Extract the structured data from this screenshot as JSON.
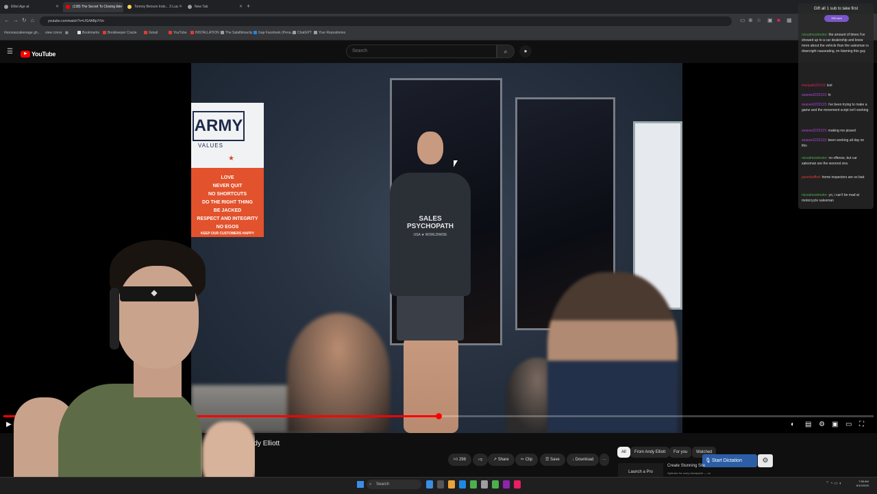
{
  "browser": {
    "tabs": [
      {
        "label": "Elliot Age at",
        "color": "#9e9e9e"
      },
      {
        "label": "(138) The Secret To Closing Eve",
        "color": "#ff0000"
      },
      {
        "label": "Tommy Benson Indo... 3 Lua",
        "color": "#ffd54f"
      },
      {
        "label": "New Tab",
        "color": "#9e9e9e"
      }
    ],
    "new_tab": "+",
    "url": "youtube.com/watch?v=LfG4ABp7rVo",
    "bookmarks": [
      {
        "label": "#sonvascaleenage gh...",
        "color": "#888888"
      },
      {
        "label": "view convs",
        "color": "#888888"
      },
      {
        "label": "Bookmarks",
        "color": "#e0e0e0"
      },
      {
        "label": "Bookkeeper Crazie",
        "color": "#e53935"
      },
      {
        "label": "Gmail",
        "color": "#e53935"
      },
      {
        "label": "YouTube",
        "color": "#e53935"
      },
      {
        "label": "INSTALLATION",
        "color": "#e53935"
      },
      {
        "label": "The Salafitimacity",
        "color": "#9e9e9e"
      },
      {
        "label": "Gap Facebook (Pena...",
        "color": "#1e88e5"
      },
      {
        "label": "ChatGPT",
        "color": "#9e9e9e"
      },
      {
        "label": "Your Repositories",
        "color": "#9e9e9e"
      }
    ]
  },
  "youtube": {
    "logo_text": "YouTube",
    "search_placeholder": "Search"
  },
  "video": {
    "poster": {
      "headline": "ARMY",
      "subhead": "VALUES",
      "star": "★",
      "lines": [
        "LOVE",
        "NEVER QUIT",
        "NO SHORTCUTS",
        "DO THE RIGHT THING",
        "BE JACKED",
        "RESPECT AND INTEGRITY",
        "NO EGOS",
        "KEEP OUR CUSTOMERS HAPPY"
      ],
      "side_text": [
        "E",
        "ING"
      ]
    },
    "shirt_line1": "SALES",
    "shirt_line2": "PSYCHOPATH",
    "shirt_sub": "USA ★ WORLDWIDE",
    "progress": 0.5
  },
  "below": {
    "title_fragment": "ch | Andy Elliott",
    "like_count": "298",
    "share": "Share",
    "clip": "Clip",
    "save": "Save",
    "download": "Download",
    "more": "···",
    "chips": [
      "All",
      "From Andy Elliott",
      "For you",
      "Watched"
    ],
    "dictation": "Start Dictation",
    "rec_thumb_text": "Launch a Pro",
    "rec_title": "Create Stunning Site",
    "rec_sub": "Optimize for every breakpoint — no"
  },
  "chat": {
    "gift_text": "Gift all 1 sub to take first",
    "pill_text": "290 sent",
    "messages": [
      {
        "user": "nicoalmostmotor:",
        "text": "the amount of times I've showed up to a car dealership and knew more about the vehicle than the salesman is downright nauseating, im blaming this guy",
        "color": "#4caf50"
      },
      {
        "user": "mariyakk2017d:",
        "text": "lool",
        "color": "#e91e63"
      },
      {
        "user": "seanen2222123:",
        "text": "hi",
        "color": "#b548e0"
      },
      {
        "user": "seanen2222123:",
        "text": "i've been trying to make a game and the movement script isn't working",
        "color": "#b548e0"
      },
      {
        "user": "seanen2222123:",
        "text": "making me pissed",
        "color": "#b548e0"
      },
      {
        "user": "seanen2222123:",
        "text": "been working all day on this",
        "color": "#b548e0"
      },
      {
        "user": "nicoalmostmotor:",
        "text": "no offense, but car salesman are the wooorst ona",
        "color": "#4caf50"
      },
      {
        "user": "jasonbuffled:",
        "text": "home inspectors are so bad",
        "color": "#e53935"
      },
      {
        "user": "nicoalmostmotor:",
        "text": "yo, i can't be mad at motorcycle salesman",
        "color": "#4caf50"
      }
    ]
  },
  "taskbar": {
    "search": "Search",
    "time": "7:58 AM",
    "date": "8/12/2025",
    "icons": [
      {
        "color": "#3b8ee6"
      },
      {
        "color": "#555555"
      },
      {
        "color": "#e8a33b"
      },
      {
        "color": "#1e88e5"
      },
      {
        "color": "#4caf50"
      },
      {
        "color": "#9e9e9e"
      },
      {
        "color": "#4caf50"
      },
      {
        "color": "#8e24aa"
      },
      {
        "color": "#e91e63"
      }
    ]
  },
  "colors": {
    "accent_red": "#ff0000",
    "chat_bg": "#282828"
  }
}
